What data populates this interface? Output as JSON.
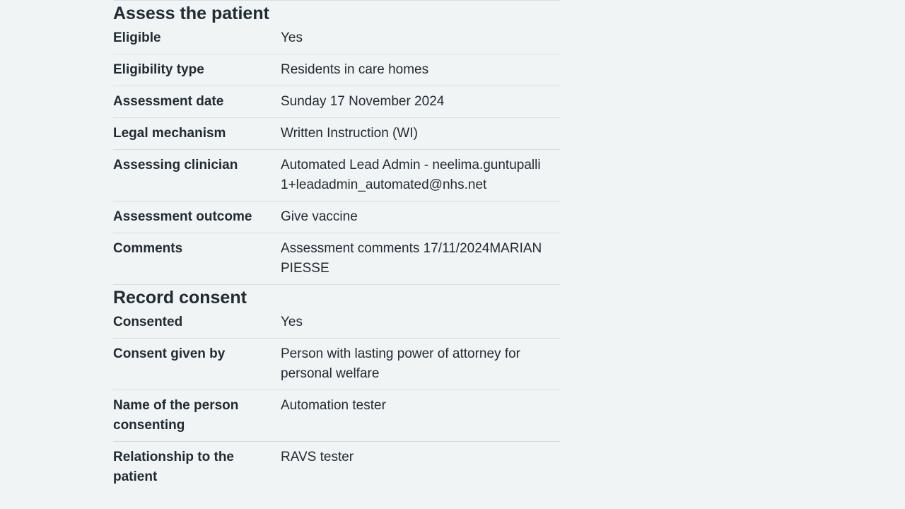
{
  "assess": {
    "heading": "Assess the patient",
    "rows": [
      {
        "label": "Eligible",
        "value": "Yes"
      },
      {
        "label": "Eligibility type",
        "value": "Residents in care homes"
      },
      {
        "label": "Assessment date",
        "value": "Sunday 17 November 2024"
      },
      {
        "label": "Legal mechanism",
        "value": "Written Instruction (WI)"
      },
      {
        "label": "Assessing clinician",
        "value": "Automated Lead Admin - neelima.guntupalli1+leadadmin_automated@nhs.net"
      },
      {
        "label": "Assessment outcome",
        "value": "Give vaccine"
      },
      {
        "label": "Comments",
        "value": "Assessment comments 17/11/2024MARIAN PIESSE"
      }
    ]
  },
  "consent": {
    "heading": "Record consent",
    "rows": [
      {
        "label": "Consented",
        "value": "Yes"
      },
      {
        "label": "Consent given by",
        "value": "Person with lasting power of attorney for personal welfare"
      },
      {
        "label": "Name of the person consenting",
        "value": "Automation tester"
      },
      {
        "label": "Relationship to the patient",
        "value": "RAVS tester"
      }
    ]
  }
}
